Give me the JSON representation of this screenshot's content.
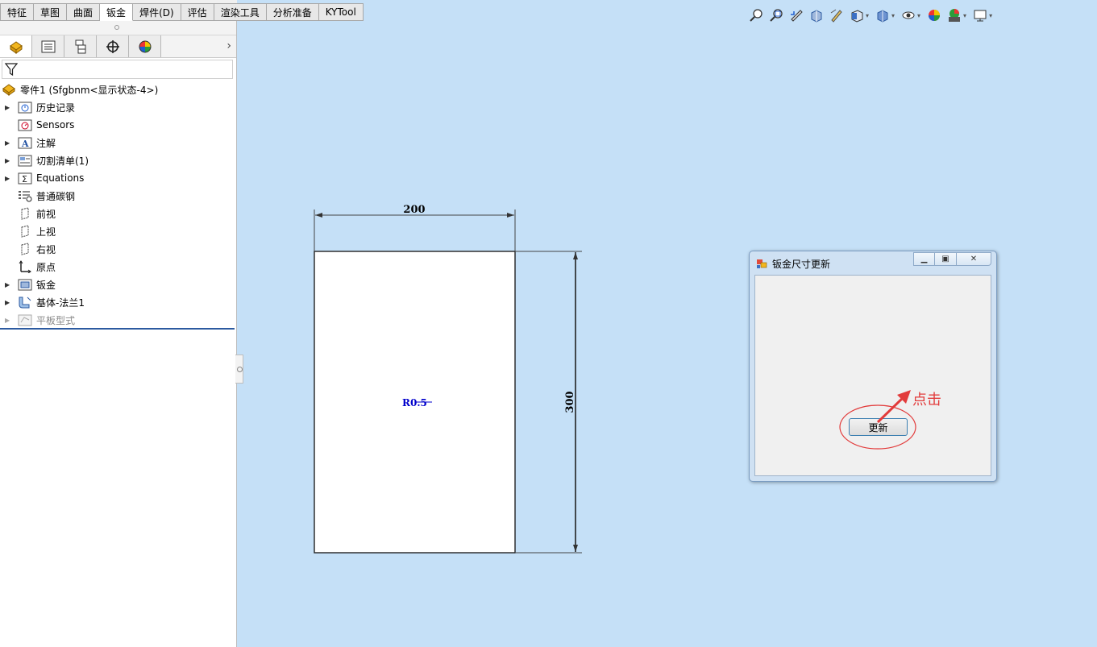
{
  "top_tabs": [
    {
      "label": "特征"
    },
    {
      "label": "草图"
    },
    {
      "label": "曲面"
    },
    {
      "label": "钣金",
      "active": true
    },
    {
      "label": "焊件(D)"
    },
    {
      "label": "评估"
    },
    {
      "label": "渲染工具"
    },
    {
      "label": "分析准备"
    },
    {
      "label": "KYTool"
    }
  ],
  "feature_tree": {
    "root_label": "零件1  (Sfgbnm<显示状态-4>)",
    "items": [
      {
        "label": "历史记录",
        "icon": "history-folder-icon",
        "expandable": true
      },
      {
        "label": "Sensors",
        "icon": "sensors-icon",
        "expandable": false
      },
      {
        "label": "注解",
        "icon": "annotations-icon",
        "expandable": true
      },
      {
        "label": "切割清单(1)",
        "icon": "cut-list-icon",
        "expandable": true
      },
      {
        "label": "Equations",
        "icon": "equations-icon",
        "expandable": true
      },
      {
        "label": "普通碳钢",
        "icon": "material-icon",
        "expandable": false
      },
      {
        "label": "前视",
        "icon": "plane-icon",
        "expandable": false
      },
      {
        "label": "上视",
        "icon": "plane-icon",
        "expandable": false
      },
      {
        "label": "右视",
        "icon": "plane-icon",
        "expandable": false
      },
      {
        "label": "原点",
        "icon": "origin-icon",
        "expandable": false
      },
      {
        "label": "钣金",
        "icon": "sheet-metal-icon",
        "expandable": true
      },
      {
        "label": "基体-法兰1",
        "icon": "base-flange-icon",
        "expandable": true
      },
      {
        "label": "平板型式",
        "icon": "flat-pattern-icon",
        "expandable": true,
        "suppressed": true
      }
    ]
  },
  "drawing": {
    "width_dimension": "200",
    "height_dimension": "300",
    "radius_note": "R0.5"
  },
  "dialog": {
    "title": "钣金尺寸更新",
    "update_button": "更新"
  },
  "annotation": {
    "text": "点击",
    "color": "#e23b3b"
  },
  "colors": {
    "viewport_background": "#c5e0f7",
    "dimension_text": "#000000",
    "radius_note": "#0000cc"
  }
}
